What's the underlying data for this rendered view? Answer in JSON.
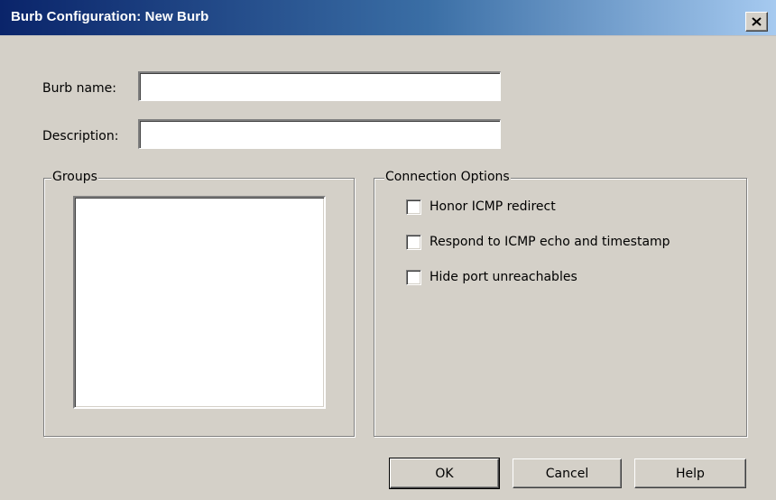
{
  "window": {
    "title": "Burb Configuration: New Burb",
    "close_icon": "close-icon"
  },
  "form": {
    "burb_name_label": "Burb name:",
    "burb_name_value": "",
    "description_label": "Description:",
    "description_value": ""
  },
  "groups": {
    "label": "Groups",
    "items": []
  },
  "connection_options": {
    "label": "Connection Options",
    "options": [
      {
        "label": "Honor ICMP redirect",
        "checked": false
      },
      {
        "label": "Respond to ICMP echo and timestamp",
        "checked": false
      },
      {
        "label": "Hide port unreachables",
        "checked": false
      }
    ]
  },
  "buttons": {
    "ok": "OK",
    "cancel": "Cancel",
    "help": "Help"
  }
}
